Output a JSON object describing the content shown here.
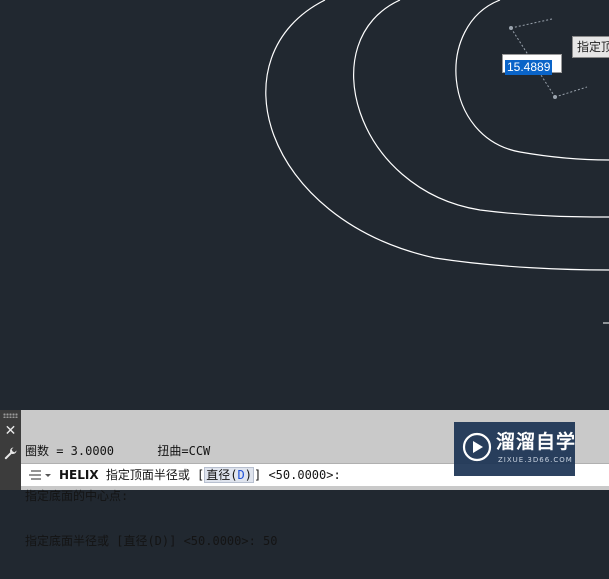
{
  "drawing": {
    "tooltip_text": "指定顶面半径或",
    "dynamic_input_value": "15.4889"
  },
  "command_history": [
    "圈数 = 3.0000      扭曲=CCW",
    "指定底面的中心点:",
    "指定底面半径或 [直径(D)] <50.0000>: 50"
  ],
  "command_line": {
    "command_name": "HELIX",
    "prompt_text": " 指定顶面半径或 [",
    "option_label": "直径(",
    "option_key": "D",
    "option_close": ")",
    "prompt_suffix": "] <50.0000>:"
  },
  "watermark": {
    "brand": "溜溜自学",
    "url": "ZIXUE.3D66.COM"
  },
  "colors": {
    "canvas_background": "#212830",
    "command_panel": "#c9c9c9",
    "selection_highlight": "#0a64c8",
    "curve": "#ffffff"
  },
  "icons": [
    "close-icon",
    "wrench-icon",
    "command-line-icon",
    "watermark-logo-icon"
  ]
}
